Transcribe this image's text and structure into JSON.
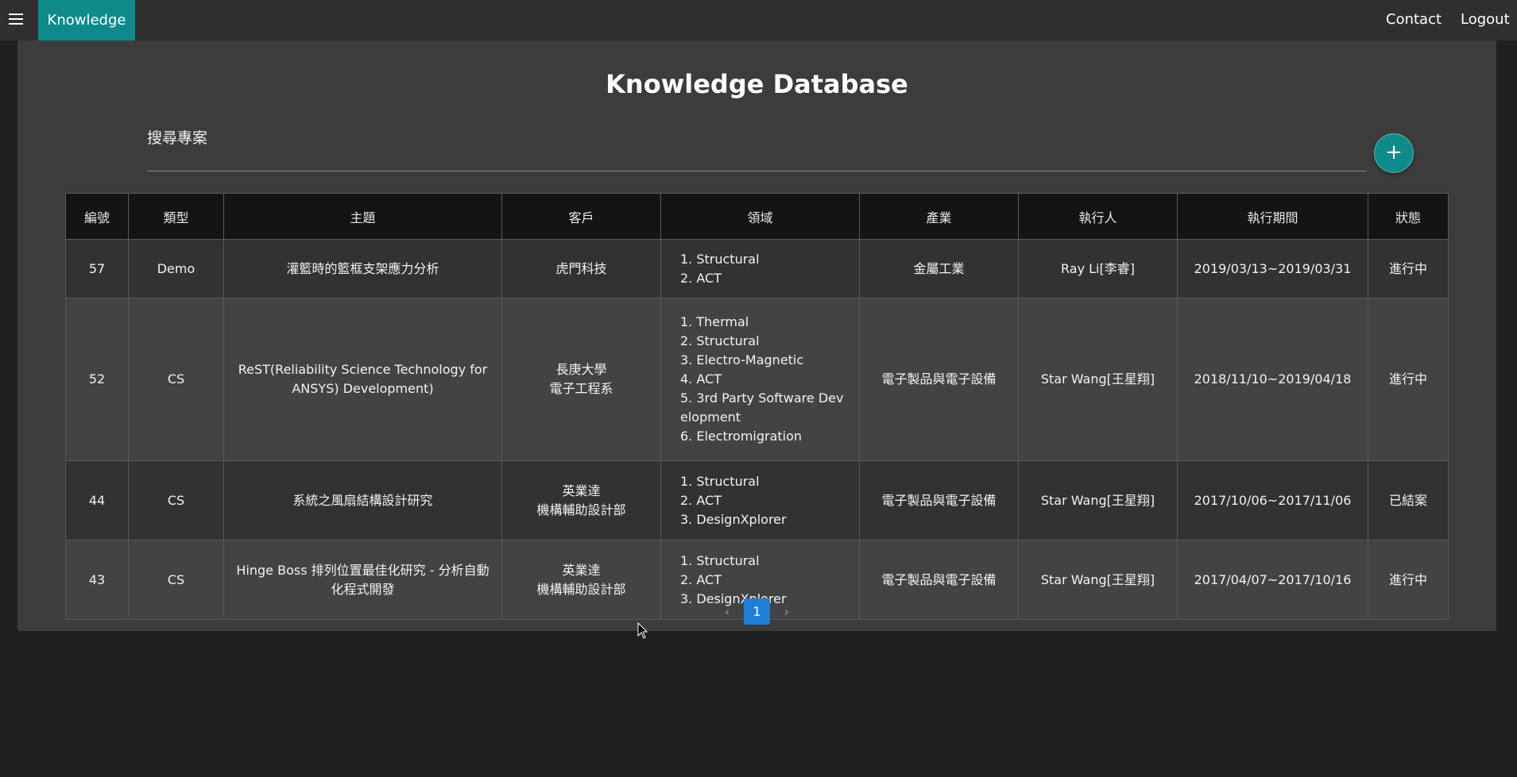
{
  "topbar": {
    "brand": "Knowledge",
    "contact": "Contact",
    "logout": "Logout"
  },
  "colors": {
    "accent": "#0e8a8a",
    "page_active": "#1f7fd6"
  },
  "page": {
    "title": "Knowledge Database",
    "search_label": "搜尋專案",
    "add_icon": "plus-icon"
  },
  "table": {
    "headers": [
      "編號",
      "類型",
      "主題",
      "客戶",
      "領域",
      "產業",
      "執行人",
      "執行期間",
      "狀態"
    ],
    "rows": [
      {
        "id": "57",
        "type": "Demo",
        "topic": "灌籃時的籃框支架應力分析",
        "client": [
          "虎門科技"
        ],
        "domains": [
          "1. Structural",
          "2. ACT"
        ],
        "industry": "金屬工業",
        "executor": "Ray Li[李睿]",
        "period": "2019/03/13~2019/03/31",
        "status": "進行中"
      },
      {
        "id": "52",
        "type": "CS",
        "topic": "ReST(Reliability Science Technology for ANSYS) Development)",
        "client": [
          "長庚大學",
          "電子工程系"
        ],
        "domains": [
          "1. Thermal",
          "2. Structural",
          "3. Electro-Magnetic",
          "4. ACT",
          "5. 3rd Party Software Development",
          "6. Electromigration"
        ],
        "industry": "電子製品與電子設備",
        "executor": "Star Wang[王星翔]",
        "period": "2018/11/10~2019/04/18",
        "status": "進行中"
      },
      {
        "id": "44",
        "type": "CS",
        "topic": "系統之風扇結構設計研究",
        "client": [
          "英業達",
          "機構輔助設計部"
        ],
        "domains": [
          "1. Structural",
          "2. ACT",
          "3. DesignXplorer"
        ],
        "industry": "電子製品與電子設備",
        "executor": "Star Wang[王星翔]",
        "period": "2017/10/06~2017/11/06",
        "status": "已結案"
      },
      {
        "id": "43",
        "type": "CS",
        "topic": "Hinge Boss 排列位置最佳化研究 - 分析自動化程式開發",
        "client": [
          "英業達",
          "機構輔助設計部"
        ],
        "domains": [
          "1. Structural",
          "2. ACT",
          "3. DesignXplorer"
        ],
        "industry": "電子製品與電子設備",
        "executor": "Star Wang[王星翔]",
        "period": "2017/04/07~2017/10/16",
        "status": "進行中"
      }
    ]
  },
  "pagination": {
    "prev": "‹",
    "current": "1",
    "next": "›"
  }
}
